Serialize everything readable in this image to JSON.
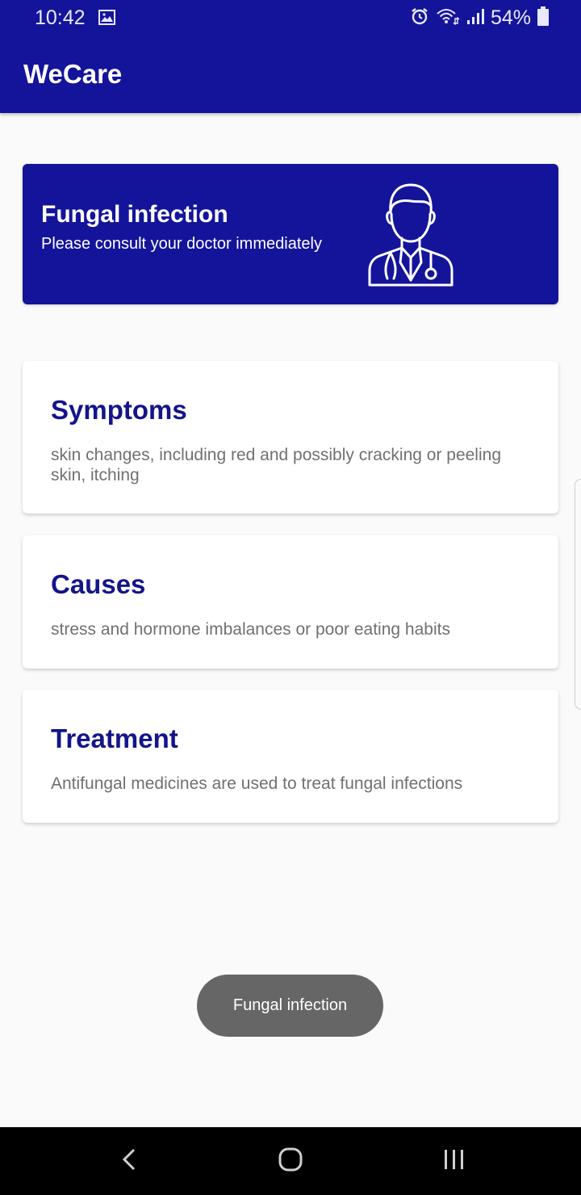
{
  "status_bar": {
    "time": "10:42",
    "battery": "54%",
    "icons": [
      "image-icon",
      "alarm-icon",
      "wifi-icon",
      "signal-icon",
      "battery-icon"
    ]
  },
  "app_bar": {
    "title": "WeCare"
  },
  "banner": {
    "title": "Fungal infection",
    "subtitle": "Please consult your doctor immediately",
    "icon": "doctor-icon"
  },
  "cards": [
    {
      "title": "Symptoms",
      "body": " skin changes, including red and possibly cracking or peeling skin, itching"
    },
    {
      "title": "Causes",
      "body": " stress and hormone imbalances or poor eating habits"
    },
    {
      "title": "Treatment",
      "body": "Antifungal medicines are used to treat fungal infections"
    }
  ],
  "toast": {
    "text": "Fungal infection"
  },
  "nav_bar": {
    "icons": [
      "back-icon",
      "home-icon",
      "recents-icon"
    ]
  },
  "colors": {
    "primary": "#14149a",
    "card_title": "#14148a",
    "body_text": "#707070",
    "toast_bg": "#666666"
  }
}
